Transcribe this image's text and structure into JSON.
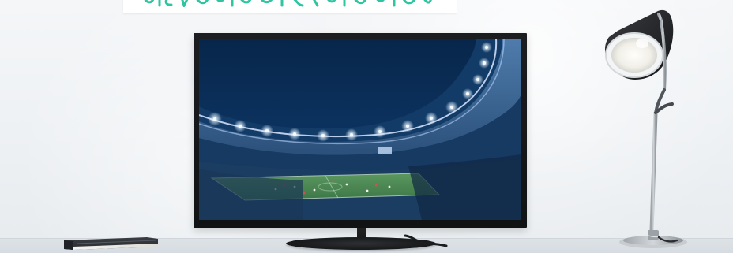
{
  "scene": {
    "type": "photo-mockup"
  },
  "colors": {
    "wall": "#f1f4f7",
    "desk": "#d9dee3",
    "banner_fragment": "#2fc4a2",
    "tv_frame": "#121416",
    "screen_night": "#0b2850",
    "stadium_lights": "#e8f1ff",
    "pitch": "#4f8d57",
    "lamp_metal": "#b7bbc0",
    "lamp_shade": "#1f2022",
    "book": "#2a2d31"
  },
  "icons": {
    "lamp": "desk-lamp-icon",
    "book": "book-icon",
    "tv": "television-icon"
  }
}
